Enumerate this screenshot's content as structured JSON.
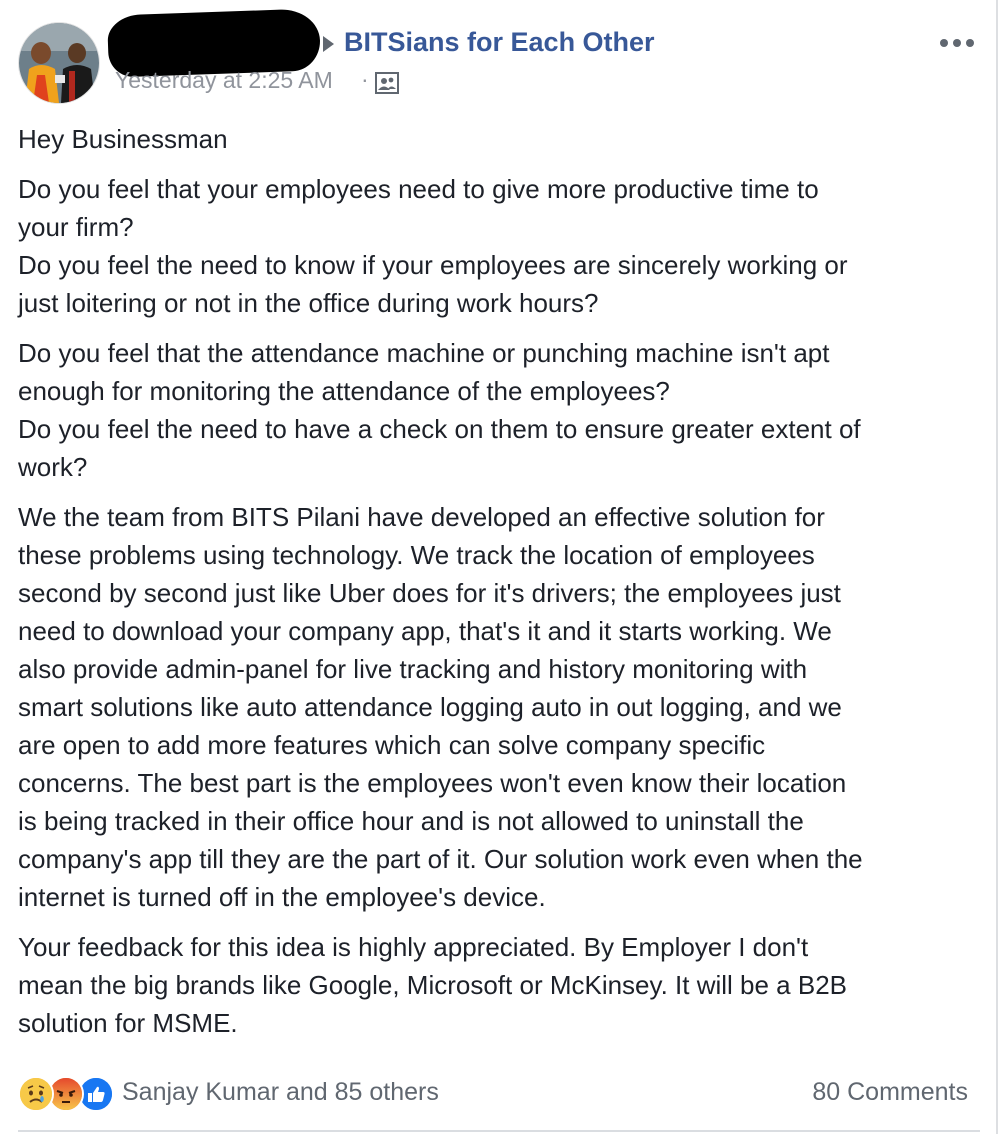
{
  "post": {
    "group_name": "BITSians for Each Other",
    "timestamp": "Yesterday at 2:25 AM",
    "separator": "·",
    "paragraphs": [
      {
        "lines": [
          "Hey Businessman"
        ]
      },
      {
        "lines": [
          "Do you feel that your employees need to give more productive time to",
          "your firm?",
          "Do you feel the need to know if your employees are sincerely working or",
          "just loitering or not in the office during work hours?"
        ]
      },
      {
        "lines": [
          "Do you feel that the attendance machine or punching machine isn't apt",
          "enough for monitoring the attendance of the employees?",
          "Do you feel the need to have a check on them to ensure greater extent of",
          "work?"
        ]
      },
      {
        "lines": [
          "We the team from BITS Pilani have developed an effective solution for",
          "these problems using technology. We track the location of employees",
          "second by second just like Uber does for it's drivers; the employees just",
          "need to download your company app, that's it and it starts working. We",
          "also provide admin-panel for live tracking and history monitoring with",
          "smart solutions like auto attendance logging auto in out logging, and we",
          "are open to add more features which can solve company specific",
          "concerns. The best part is the employees won't even know their location",
          "is being tracked in their office hour and is not allowed to uninstall the",
          "company's app till they are the part of it. Our solution work even when the",
          "internet is turned off in the employee's device."
        ]
      },
      {
        "lines": [
          "Your feedback for this idea is highly appreciated. By Employer I don't",
          "mean the big brands like Google, Microsoft or McKinsey. It will be a B2B",
          "solution for MSME."
        ]
      }
    ]
  },
  "footer": {
    "reactions_text": "Sanjay Kumar and 85 others",
    "reaction_icons": [
      "sad-icon",
      "angry-icon",
      "like-icon"
    ],
    "comments_text": "80 Comments"
  },
  "icons": {
    "header": [
      "caret-right-icon",
      "audience-icon",
      "more-options-icon"
    ]
  },
  "colors": {
    "link": "#385898",
    "meta": "#90949c",
    "text": "#1d2129",
    "like": "#1877f2",
    "angry": "#e9710f",
    "sad": "#f7b125"
  }
}
